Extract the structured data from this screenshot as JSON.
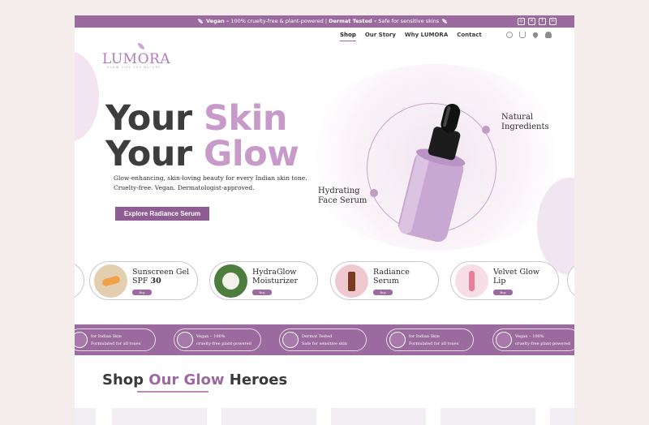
{
  "announcement": {
    "vegan_bold": "Vegan –",
    "vegan_text": " 100% cruelty-free & plant-powered | ",
    "dermat_bold": "Dermat Tested –",
    "dermat_text": " Safe for sensitive skins"
  },
  "social_icons": [
    "instagram-icon",
    "x-icon",
    "facebook-icon",
    "linkedin-icon"
  ],
  "brand": {
    "name": "LUMORA",
    "tagline": "GLOW LIKE THE NATURE"
  },
  "nav": [
    "Shop",
    "Our Story",
    "Why LUMORA",
    "Contact"
  ],
  "header_icons": [
    "search-icon",
    "cart-icon",
    "heart-icon",
    "user-icon"
  ],
  "hero": {
    "line1_a": "Your ",
    "line1_b": "Skin",
    "line2_a": "Your ",
    "line2_b": "Glow",
    "sub1": "Glow-enhancing, skin-loving beauty for every Indian skin tone.",
    "sub2": "Cruelty-free. Vegan. Dermatologist-approved.",
    "cta": "Explore Radiance Serum",
    "label_natural_1": "Natural",
    "label_natural_2": "Ingredients",
    "label_hydrating_1": "Hydrating",
    "label_hydrating_2": "Face Serum"
  },
  "products": [
    {
      "line1": "Sunscreen Gel",
      "line2": "SPF ",
      "line2b": "30",
      "buy": "Buy"
    },
    {
      "line1": "HydraGlow",
      "line2": "Moisturizer",
      "line2b": "",
      "buy": "Buy"
    },
    {
      "line1": "Radiance",
      "line2": "Serum",
      "line2b": "",
      "buy": "Buy"
    },
    {
      "line1": "Velvet Glow",
      "line2": "Lip",
      "line2b": "",
      "buy": "Buy"
    }
  ],
  "badges": [
    {
      "l1": "for Indian Skin",
      "l2": "Formulated for all tones"
    },
    {
      "l1": "Vegan – 100%",
      "l2": "cruelty-free plant-powered"
    },
    {
      "l1": "Dermat Tested",
      "l2": "Safe for sensitive skin"
    },
    {
      "l1": "for Indian Skin",
      "l2": "Formulated for all tones"
    },
    {
      "l1": "Vegan – 100%",
      "l2": "cruelty-free plant-powered"
    }
  ],
  "section": {
    "t1": "Shop ",
    "t2": "Our Glow",
    "t3": " Heroes"
  },
  "colors": {
    "brand_purple": "#9b6a9e",
    "accent_lilac": "#c79ac9",
    "page_bg": "#f5ecec"
  }
}
